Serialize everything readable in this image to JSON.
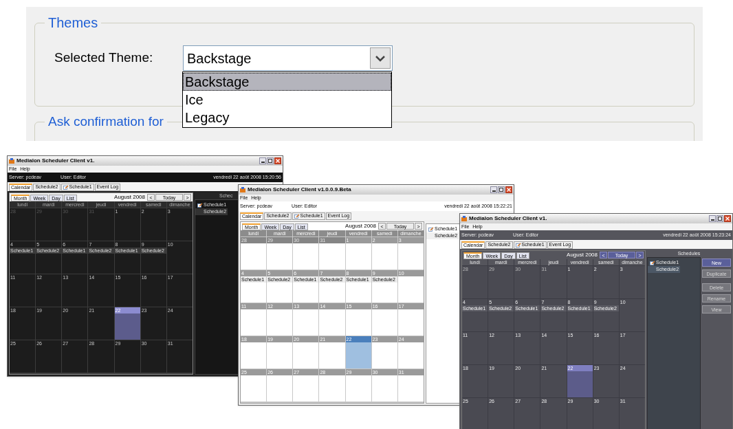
{
  "theme_settings": {
    "group_title": "Themes",
    "label": "Selected Theme:",
    "value": "Backstage",
    "expanded": true,
    "options": [
      {
        "label": "Backstage",
        "selected": true
      },
      {
        "label": "Ice",
        "selected": false
      },
      {
        "label": "Legacy",
        "selected": false
      }
    ],
    "next_group_title": "Ask confirmation for"
  },
  "windows": [
    {
      "kind": "dark",
      "title": "Medialon Scheduler Client v1.",
      "menu": [
        "File",
        "Help"
      ],
      "server": "Server: pcdeav",
      "user": "User: Editor",
      "datetime": "vendredi 22 août 2008 15:20:56",
      "tabs": [
        {
          "label": "Calendar",
          "selected": true,
          "icon": false
        },
        {
          "label": "Schedule2",
          "selected": false,
          "icon": false
        },
        {
          "label": "Schedule1",
          "selected": false,
          "icon": true
        },
        {
          "label": "Event Log",
          "selected": false,
          "icon": false
        }
      ],
      "views": [
        {
          "label": "Month",
          "selected": true
        },
        {
          "label": "Week",
          "selected": false
        },
        {
          "label": "Day",
          "selected": false
        },
        {
          "label": "List",
          "selected": false
        }
      ],
      "month": "August 2008",
      "prev": "<",
      "today": "Today",
      "next": ">",
      "weekdays": [
        "lundi",
        "mardi",
        "mercredi",
        "jeudi",
        "vendredi",
        "samedi",
        "dimanche"
      ],
      "weeks": [
        {
          "days": [
            {
              "day": "28",
              "other_month": true,
              "selected": false
            },
            {
              "day": "29",
              "other_month": true,
              "selected": false
            },
            {
              "day": "30",
              "other_month": true,
              "selected": false
            },
            {
              "day": "31",
              "other_month": true,
              "selected": false
            },
            {
              "day": "1",
              "other_month": false,
              "selected": false
            },
            {
              "day": "2",
              "other_month": false,
              "selected": false
            },
            {
              "day": "3",
              "other_month": false,
              "selected": false
            }
          ]
        },
        {
          "days": [
            {
              "day": "4",
              "other_month": false,
              "selected": false,
              "event": "Schedule1"
            },
            {
              "day": "5",
              "other_month": false,
              "selected": false,
              "event": "Schedule2"
            },
            {
              "day": "6",
              "other_month": false,
              "selected": false,
              "event": "Schedule1"
            },
            {
              "day": "7",
              "other_month": false,
              "selected": false,
              "event": "Schedule2"
            },
            {
              "day": "8",
              "other_month": false,
              "selected": false,
              "event": "Schedule1"
            },
            {
              "day": "9",
              "other_month": false,
              "selected": false,
              "event": "Schedule2"
            },
            {
              "day": "10",
              "other_month": false,
              "selected": false
            }
          ]
        },
        {
          "days": [
            {
              "day": "11",
              "other_month": false,
              "selected": false
            },
            {
              "day": "12",
              "other_month": false,
              "selected": false
            },
            {
              "day": "13",
              "other_month": false,
              "selected": false
            },
            {
              "day": "14",
              "other_month": false,
              "selected": false
            },
            {
              "day": "15",
              "other_month": false,
              "selected": false
            },
            {
              "day": "16",
              "other_month": false,
              "selected": false
            },
            {
              "day": "17",
              "other_month": false,
              "selected": false
            }
          ]
        },
        {
          "days": [
            {
              "day": "18",
              "other_month": false,
              "selected": false
            },
            {
              "day": "19",
              "other_month": false,
              "selected": false
            },
            {
              "day": "20",
              "other_month": false,
              "selected": false
            },
            {
              "day": "21",
              "other_month": false,
              "selected": false
            },
            {
              "day": "22",
              "other_month": false,
              "selected": true
            },
            {
              "day": "23",
              "other_month": false,
              "selected": false
            },
            {
              "day": "24",
              "other_month": false,
              "selected": false
            }
          ]
        },
        {
          "days": [
            {
              "day": "25",
              "other_month": false,
              "selected": false
            },
            {
              "day": "26",
              "other_month": false,
              "selected": false
            },
            {
              "day": "27",
              "other_month": false,
              "selected": false
            },
            {
              "day": "28",
              "other_month": false,
              "selected": false
            },
            {
              "day": "29",
              "other_month": false,
              "selected": false
            },
            {
              "day": "30",
              "other_month": false,
              "selected": false
            },
            {
              "day": "31",
              "other_month": false,
              "selected": false
            }
          ]
        }
      ],
      "sidebar_title": "Schec",
      "schedules": [
        {
          "label": "Schedule1",
          "selected": false,
          "icon": true
        },
        {
          "label": "Schedule2",
          "selected": true,
          "icon": false
        }
      ]
    },
    {
      "kind": "light",
      "title": "Medialon Scheduler Client v1.0.0.9.Beta",
      "menu": [
        "File",
        "Help"
      ],
      "server": "Server: pcdeav",
      "user": "User: Editor",
      "datetime": "vendredi 22 août 2008 15:22:21",
      "tabs": [
        {
          "label": "Calendar",
          "selected": true,
          "icon": false
        },
        {
          "label": "Schedule2",
          "selected": false,
          "icon": false
        },
        {
          "label": "Schedule1",
          "selected": false,
          "icon": true
        },
        {
          "label": "Event Log",
          "selected": false,
          "icon": false
        }
      ],
      "views": [
        {
          "label": "Month",
          "selected": true
        },
        {
          "label": "Week",
          "selected": false
        },
        {
          "label": "Day",
          "selected": false
        },
        {
          "label": "List",
          "selected": false
        }
      ],
      "month": "August 2008",
      "prev": "<",
      "today": "Today",
      "next": ">",
      "weekdays": [
        "lundi",
        "mardi",
        "mercredi",
        "jeudi",
        "vendredi",
        "samedi",
        "dimanche"
      ],
      "weeks": [
        {
          "days": [
            {
              "day": "28",
              "other_month": true,
              "selected": false
            },
            {
              "day": "29",
              "other_month": true,
              "selected": false
            },
            {
              "day": "30",
              "other_month": true,
              "selected": false
            },
            {
              "day": "31",
              "other_month": true,
              "selected": false
            },
            {
              "day": "1",
              "other_month": false,
              "selected": false
            },
            {
              "day": "2",
              "other_month": false,
              "selected": false
            },
            {
              "day": "3",
              "other_month": false,
              "selected": false
            }
          ]
        },
        {
          "days": [
            {
              "day": "4",
              "other_month": false,
              "selected": false,
              "event": "Schedule1"
            },
            {
              "day": "5",
              "other_month": false,
              "selected": false,
              "event": "Schedule2"
            },
            {
              "day": "6",
              "other_month": false,
              "selected": false,
              "event": "Schedule1"
            },
            {
              "day": "7",
              "other_month": false,
              "selected": false,
              "event": "Schedule2"
            },
            {
              "day": "8",
              "other_month": false,
              "selected": false,
              "event": "Schedule1"
            },
            {
              "day": "9",
              "other_month": false,
              "selected": false,
              "event": "Schedule2"
            },
            {
              "day": "10",
              "other_month": false,
              "selected": false
            }
          ]
        },
        {
          "days": [
            {
              "day": "11",
              "other_month": false,
              "selected": false
            },
            {
              "day": "12",
              "other_month": false,
              "selected": false
            },
            {
              "day": "13",
              "other_month": false,
              "selected": false
            },
            {
              "day": "14",
              "other_month": false,
              "selected": false
            },
            {
              "day": "15",
              "other_month": false,
              "selected": false
            },
            {
              "day": "16",
              "other_month": false,
              "selected": false
            },
            {
              "day": "17",
              "other_month": false,
              "selected": false
            }
          ]
        },
        {
          "days": [
            {
              "day": "18",
              "other_month": false,
              "selected": false
            },
            {
              "day": "19",
              "other_month": false,
              "selected": false
            },
            {
              "day": "20",
              "other_month": false,
              "selected": false
            },
            {
              "day": "21",
              "other_month": false,
              "selected": false
            },
            {
              "day": "22",
              "other_month": false,
              "selected": true
            },
            {
              "day": "23",
              "other_month": false,
              "selected": false
            },
            {
              "day": "24",
              "other_month": false,
              "selected": false
            }
          ]
        },
        {
          "days": [
            {
              "day": "25",
              "other_month": false,
              "selected": false
            },
            {
              "day": "26",
              "other_month": false,
              "selected": false
            },
            {
              "day": "27",
              "other_month": false,
              "selected": false
            },
            {
              "day": "28",
              "other_month": false,
              "selected": false
            },
            {
              "day": "29",
              "other_month": false,
              "selected": false
            },
            {
              "day": "30",
              "other_month": false,
              "selected": false
            },
            {
              "day": "31",
              "other_month": false,
              "selected": false
            }
          ]
        }
      ],
      "schedules": [
        {
          "label": "Schedule1",
          "selected": false,
          "icon": true
        },
        {
          "label": "Schedule2",
          "selected": true,
          "icon": false
        }
      ]
    },
    {
      "kind": "slate",
      "title": "Medialon Scheduler Client v1.",
      "menu": [
        "File",
        "Help"
      ],
      "server": "Server: pcdeav",
      "user": "User: Editor",
      "datetime": "vendredi 22 août 2008 15:23:24",
      "tabs": [
        {
          "label": "Calendar",
          "selected": true,
          "icon": false
        },
        {
          "label": "Schedule2",
          "selected": false,
          "icon": false
        },
        {
          "label": "Schedule1",
          "selected": false,
          "icon": true
        },
        {
          "label": "Event Log",
          "selected": false,
          "icon": false
        }
      ],
      "views": [
        {
          "label": "Month",
          "selected": true
        },
        {
          "label": "Week",
          "selected": false
        },
        {
          "label": "Day",
          "selected": false
        },
        {
          "label": "List",
          "selected": false
        }
      ],
      "month": "August 2008",
      "prev": "<",
      "today": "Today",
      "next": ">",
      "weekdays": [
        "lundi",
        "mardi",
        "mercredi",
        "jeudi",
        "vendredi",
        "samedi",
        "dimanche"
      ],
      "weeks": [
        {
          "days": [
            {
              "day": "28",
              "other_month": true,
              "selected": false
            },
            {
              "day": "29",
              "other_month": true,
              "selected": false
            },
            {
              "day": "30",
              "other_month": true,
              "selected": false
            },
            {
              "day": "31",
              "other_month": true,
              "selected": false
            },
            {
              "day": "1",
              "other_month": false,
              "selected": false
            },
            {
              "day": "2",
              "other_month": false,
              "selected": false
            },
            {
              "day": "3",
              "other_month": false,
              "selected": false
            }
          ]
        },
        {
          "days": [
            {
              "day": "4",
              "other_month": false,
              "selected": false,
              "event": "Schedule1"
            },
            {
              "day": "5",
              "other_month": false,
              "selected": false,
              "event": "Schedule2"
            },
            {
              "day": "6",
              "other_month": false,
              "selected": false,
              "event": "Schedule1"
            },
            {
              "day": "7",
              "other_month": false,
              "selected": false,
              "event": "Schedule2"
            },
            {
              "day": "8",
              "other_month": false,
              "selected": false,
              "event": "Schedule1"
            },
            {
              "day": "9",
              "other_month": false,
              "selected": false,
              "event": "Schedule2"
            },
            {
              "day": "10",
              "other_month": false,
              "selected": false
            }
          ]
        },
        {
          "days": [
            {
              "day": "11",
              "other_month": false,
              "selected": false
            },
            {
              "day": "12",
              "other_month": false,
              "selected": false
            },
            {
              "day": "13",
              "other_month": false,
              "selected": false
            },
            {
              "day": "14",
              "other_month": false,
              "selected": false
            },
            {
              "day": "15",
              "other_month": false,
              "selected": false
            },
            {
              "day": "16",
              "other_month": false,
              "selected": false
            },
            {
              "day": "17",
              "other_month": false,
              "selected": false
            }
          ]
        },
        {
          "days": [
            {
              "day": "18",
              "other_month": false,
              "selected": false
            },
            {
              "day": "19",
              "other_month": false,
              "selected": false
            },
            {
              "day": "20",
              "other_month": false,
              "selected": false
            },
            {
              "day": "21",
              "other_month": false,
              "selected": false
            },
            {
              "day": "22",
              "other_month": false,
              "selected": true
            },
            {
              "day": "23",
              "other_month": false,
              "selected": false
            },
            {
              "day": "24",
              "other_month": false,
              "selected": false
            }
          ]
        },
        {
          "days": [
            {
              "day": "25",
              "other_month": false,
              "selected": false
            },
            {
              "day": "26",
              "other_month": false,
              "selected": false
            },
            {
              "day": "27",
              "other_month": false,
              "selected": false
            },
            {
              "day": "28",
              "other_month": false,
              "selected": false
            },
            {
              "day": "29",
              "other_month": false,
              "selected": false
            },
            {
              "day": "30",
              "other_month": false,
              "selected": false
            },
            {
              "day": "31",
              "other_month": false,
              "selected": false
            }
          ]
        }
      ],
      "sidebar_title": "Schedules",
      "schedules": [
        {
          "label": "Schedule1",
          "selected": false,
          "icon": true
        },
        {
          "label": "Schedule2",
          "selected": true,
          "icon": false
        }
      ],
      "button_groups": [
        [
          {
            "label": "New",
            "disabled": false
          },
          {
            "label": "Duplicate",
            "disabled": true
          }
        ],
        [
          {
            "label": "Delete",
            "disabled": true
          },
          {
            "label": "Rename",
            "disabled": true
          },
          {
            "label": "View",
            "disabled": true
          }
        ]
      ]
    }
  ]
}
